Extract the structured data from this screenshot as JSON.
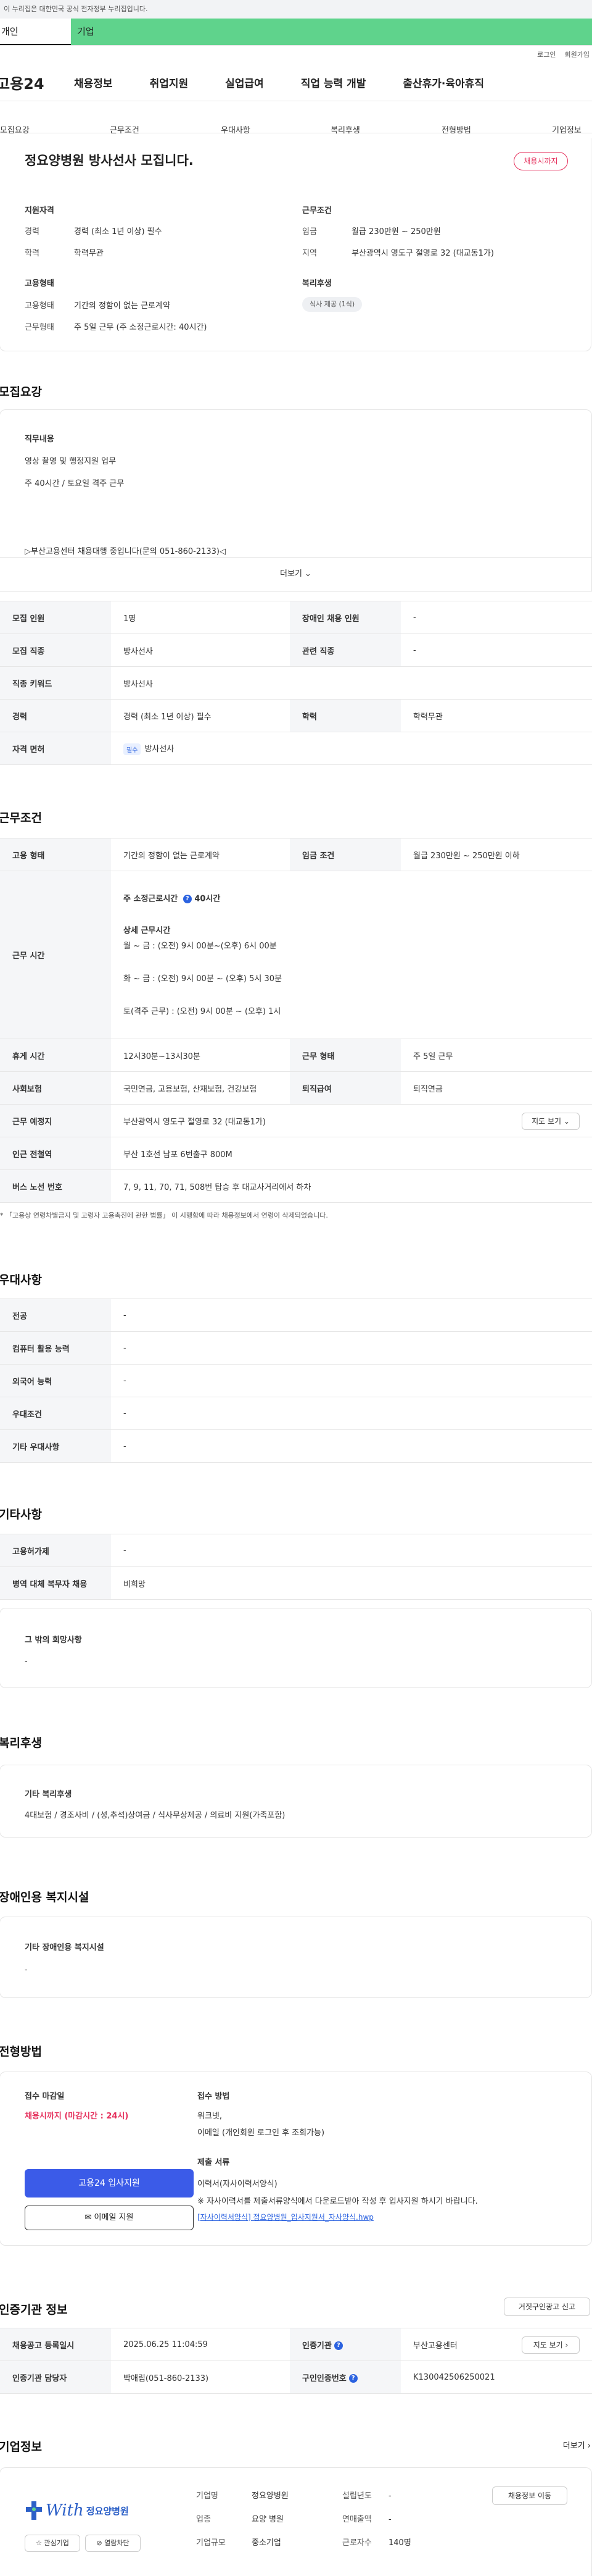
{
  "top": {
    "gov_notice": "이 누리집은 대한민국 공식 전자정부 누리집입니다.",
    "tab_personal": "개인",
    "tab_company": "기업",
    "login": "로그인",
    "signup": "회원가입"
  },
  "gnb": {
    "logo": "고용24",
    "items": [
      "채용정보",
      "취업지원",
      "실업급여",
      "직업 능력 개발",
      "출산휴가·육아휴직"
    ]
  },
  "anchors": [
    "모집요강",
    "근무조건",
    "우대사항",
    "복리후생",
    "전형방법",
    "기업정보"
  ],
  "summary": {
    "title": "정요양병원 방사선사 모집니다.",
    "badge": "채용시까지",
    "qual_label": "지원자격",
    "career_k": "경력",
    "career_v": "경력 (최소 1년 이상) 필수",
    "edu_k": "학력",
    "edu_v": "학력무관",
    "cond_label": "근무조건",
    "wage_k": "임금",
    "wage_v": "월급 230만원 ~ 250만원",
    "region_k": "지역",
    "region_v": "부산광역시 영도구 절영로 32 (대교동1가)",
    "emp_label": "고용형태",
    "type_k": "고용형태",
    "type_v": "기간의 정함이 없는 근로계약",
    "work_k": "근무형태",
    "work_v": "주 5일 근무 (주 소정근로시간: 40시간)",
    "welfare_label": "복리후생",
    "welfare_chip": "식사 제공 (1식)"
  },
  "recruit": {
    "heading": "모집요강",
    "duty_label": "직무내용",
    "duty_line1": "영상 촬영 및 행정지원 업무",
    "duty_line2": "주 40시간 / 토요일 격주 근무",
    "duty_line3": "▷부산고용센터 채용대행 중입니다(문의 051-860-2133)◁",
    "more": "더보기 ⌄",
    "rows": {
      "count_k": "모집 인원",
      "count_v": "1명",
      "disabled_k": "장애인 채용 인원",
      "disabled_v": "-",
      "job_k": "모집 직종",
      "job_v": "방사선사",
      "rel_k": "관련 직종",
      "rel_v": "-",
      "kw_k": "직종 키워드",
      "kw_v": "방사선사",
      "career_k": "경력",
      "career_v": "경력 (최소 1년 이상) 필수",
      "edu_k": "학력",
      "edu_v": "학력무관",
      "lic_k": "자격 면허",
      "lic_badge": "필수",
      "lic_v": "방사선사"
    }
  },
  "conditions": {
    "heading": "근무조건",
    "type_k": "고용 형태",
    "type_v": "기간의 정함이 없는 근로계약",
    "wage_k": "임금 조건",
    "wage_v": "월급 230만원 ~ 250만원 이하",
    "time_k": "근무 시간",
    "time_l1": "주 소정근로시간",
    "time_l1b": "40시간",
    "time_l2": "상세 근무시간",
    "time_l3": "월 ~ 금 : (오전) 9시 00분~(오후) 6시 00분",
    "time_l4": "화 ~ 금 : (오전) 9시 00분 ~ (오후) 5시 30분",
    "time_l5": "토(격주 근무) : (오전) 9시 00분 ~ (오후) 1시",
    "rest_k": "휴게 시간",
    "rest_v": "12시30분~13시30분",
    "form_k": "근무 형태",
    "form_v": "주 5일 근무",
    "ins_k": "사회보험",
    "ins_v": "국민연금, 고용보험, 산재보험, 건강보험",
    "sev_k": "퇴직급여",
    "sev_v": "퇴직연금",
    "place_k": "근무 예정지",
    "place_v": "부산광역시 영도구 절영로 32 (대교동1가)",
    "map_btn": "지도 보기 ⌄",
    "station_k": "인근 전철역",
    "station_v": "부산 1호선 남포 6번출구 800M",
    "bus_k": "버스 노선 번호",
    "bus_v": "7, 9, 11, 70, 71, 508번 탑승 후 대교사거리에서 하차",
    "note": "* 「고용상 연령차별금지 및 고령자 고용촉진에 관한 법률」 이 시행함에 따라 채용정보에서 연령이 삭제되었습니다."
  },
  "prefer": {
    "heading": "우대사항",
    "major_k": "전공",
    "major_v": "-",
    "pc_k": "컴퓨터 활용 능력",
    "pc_v": "-",
    "lang_k": "외국어 능력",
    "lang_v": "-",
    "cond_k": "우대조건",
    "cond_v": "-",
    "etc_k": "기타 우대사항",
    "etc_v": "-"
  },
  "other": {
    "heading": "기타사항",
    "permit_k": "고용허가제",
    "permit_v": "-",
    "military_k": "병역 대체 복무자 채용",
    "military_v": "비희망",
    "wish_label": "그 밖의 희망사항",
    "wish_v": "-"
  },
  "welfare": {
    "heading": "복리후생",
    "label": "기타 복리후생",
    "value": "4대보험 / 경조사비 / (성,추석)상여금 / 식사무상제공 / 의료비 지원(가족포함)"
  },
  "disability": {
    "heading": "장애인용 복지시설",
    "label": "기타 장애인용 복지시설",
    "value": "-"
  },
  "screening": {
    "heading": "전형방법",
    "deadline_label": "접수 마감일",
    "deadline_v": "채용시까지 (마감시간 : 24시)",
    "apply_btn": "고용24 입사지원",
    "email_btn": "✉ 이메일 지원",
    "method_label": "접수 방법",
    "method_l1": "워크넷,",
    "method_l2": "이메일 (개인회원 로그인 후 조회가능)",
    "docs_label": "제출 서류",
    "docs_l1": "이력서(자사이력서양식)",
    "docs_l2": "※ 자사이력서를 제출서류양식에서 다운로드받아 작성 후 입사지원 하시기 바랍니다.",
    "file": "[자사이력서양식] 정요양병원_입사지원서_자사양식.hwp"
  },
  "cert": {
    "heading": "인증기관 정보",
    "report_btn": "거짓구인광고 신고",
    "date_k": "채용공고 등록일시",
    "date_v": "2025.06.25 11:04:59",
    "agency_k": "인증기관",
    "agency_v": "부산고용센터",
    "map_btn": "지도 보기 ›",
    "manager_k": "인증기관 담당자",
    "manager_v": "박애림(051-860-2133)",
    "no_k": "구인인증번호",
    "no_v": "K130042506250021"
  },
  "company": {
    "heading": "기업정보",
    "more": "더보기 ›",
    "logo_text": "With",
    "logo_name": "정요양병원",
    "fav_btn": "☆ 관심기업",
    "block_btn": "⊘ 열람차단",
    "name_k": "기업명",
    "name_v": "정요양병원",
    "industry_k": "업종",
    "industry_v": "요양 병원",
    "scale_k": "기업규모",
    "scale_v": "중소기업",
    "founded_k": "설립년도",
    "founded_v": "-",
    "revenue_k": "연매출액",
    "revenue_v": "-",
    "staff_k": "근로자수",
    "staff_v": "140명",
    "hire_btn": "채용정보 이동"
  },
  "colors": {
    "brand_green": "#5fd38c",
    "accent_red": "#e5305c",
    "primary_blue": "#3b5be8"
  }
}
